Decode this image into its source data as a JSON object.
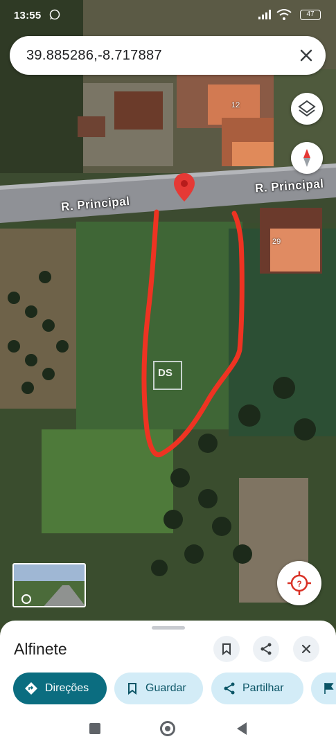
{
  "status": {
    "time": "13:55",
    "battery": "47"
  },
  "search": {
    "query": "39.885286,-8.717887"
  },
  "map": {
    "street_label_left": "R. Principal",
    "street_label_right": "R. Principal",
    "house_number_a": "12",
    "house_number_b": "29",
    "watermark": "DS"
  },
  "sheet": {
    "title": "Alfinete",
    "actions": {
      "directions": "Direções",
      "save": "Guardar",
      "share": "Partilhar"
    }
  },
  "colors": {
    "accent": "#0b6d80",
    "chip_bg": "#d3ecf7",
    "pin": "#e53935",
    "boundary": "#ee3322"
  }
}
